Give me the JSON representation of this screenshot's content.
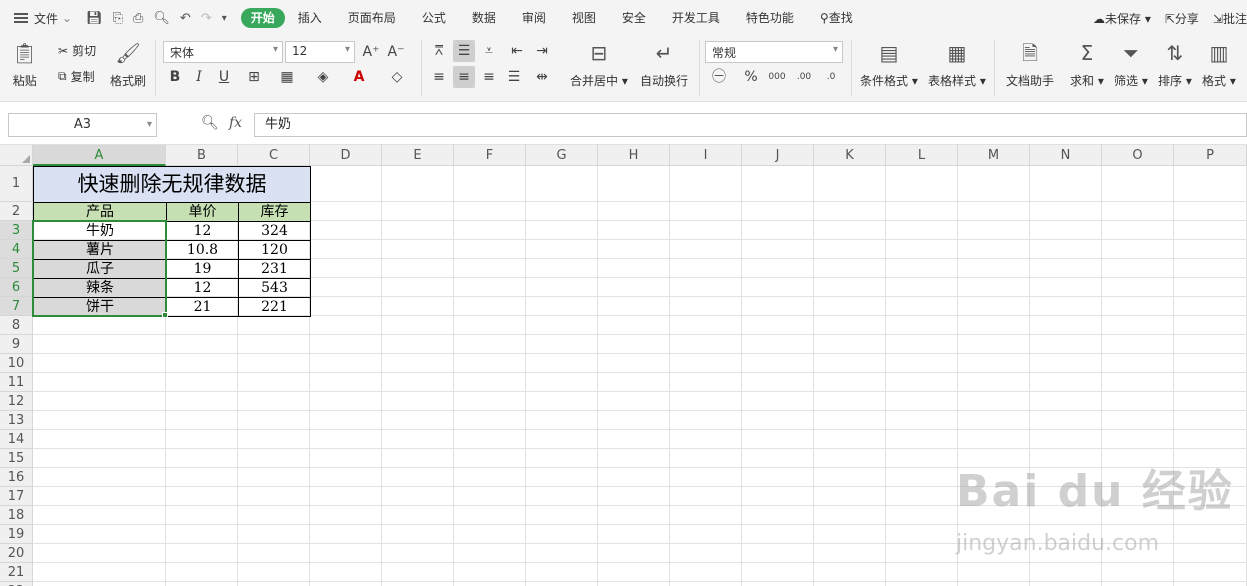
{
  "menubar": {
    "file_label": "文件",
    "tabs": [
      {
        "label": "开始",
        "active": true
      },
      {
        "label": "插入"
      },
      {
        "label": "页面布局"
      },
      {
        "label": "公式"
      },
      {
        "label": "数据"
      },
      {
        "label": "审阅"
      },
      {
        "label": "视图"
      },
      {
        "label": "安全"
      },
      {
        "label": "开发工具"
      },
      {
        "label": "特色功能"
      }
    ],
    "search_label": "查找",
    "unsaved_label": "未保存",
    "share_label": "分享",
    "annotate_label": "批注",
    "accent_color": "#38a95c"
  },
  "toolbar": {
    "paste_label": "粘贴",
    "cut_label": "剪切",
    "copy_label": "复制",
    "format_painter_label": "格式刷",
    "font_name": "宋体",
    "font_size": "12",
    "bold": "B",
    "italic": "I",
    "underline": "U",
    "merge_center_label": "合并居中",
    "wrap_text_label": "自动换行",
    "number_format": "常规",
    "conditional_format_label": "条件格式",
    "table_style_label": "表格样式",
    "doc_assistant_label": "文档助手",
    "sum_label": "求和",
    "filter_label": "筛选",
    "sort_label": "排序",
    "format_label": "格式"
  },
  "formula_bar": {
    "name_box": "A3",
    "fx_label": "fx",
    "content": "牛奶"
  },
  "sheet": {
    "columns": [
      "A",
      "B",
      "C",
      "D",
      "E",
      "F",
      "G",
      "H",
      "I",
      "J",
      "K",
      "L",
      "M",
      "N",
      "O",
      "P"
    ],
    "rows": [
      "1",
      "2",
      "3",
      "4",
      "5",
      "6",
      "7",
      "8",
      "9",
      "10",
      "11",
      "12",
      "13",
      "14",
      "15",
      "16",
      "17",
      "18",
      "19",
      "20",
      "21",
      "22"
    ],
    "selected_column": "A",
    "selected_rows": [
      "3",
      "4",
      "5",
      "6",
      "7"
    ],
    "title": "快速删除无规律数据",
    "headers": [
      "产品",
      "单价",
      "库存"
    ],
    "data": [
      [
        "牛奶",
        "12",
        "324"
      ],
      [
        "薯片",
        "10.8",
        "120"
      ],
      [
        "瓜子",
        "19",
        "231"
      ],
      [
        "辣条",
        "12",
        "543"
      ],
      [
        "饼干",
        "21",
        "221"
      ]
    ]
  },
  "watermark": {
    "line1": "Bai du 经验",
    "line2": "jingyan.baidu.com"
  }
}
